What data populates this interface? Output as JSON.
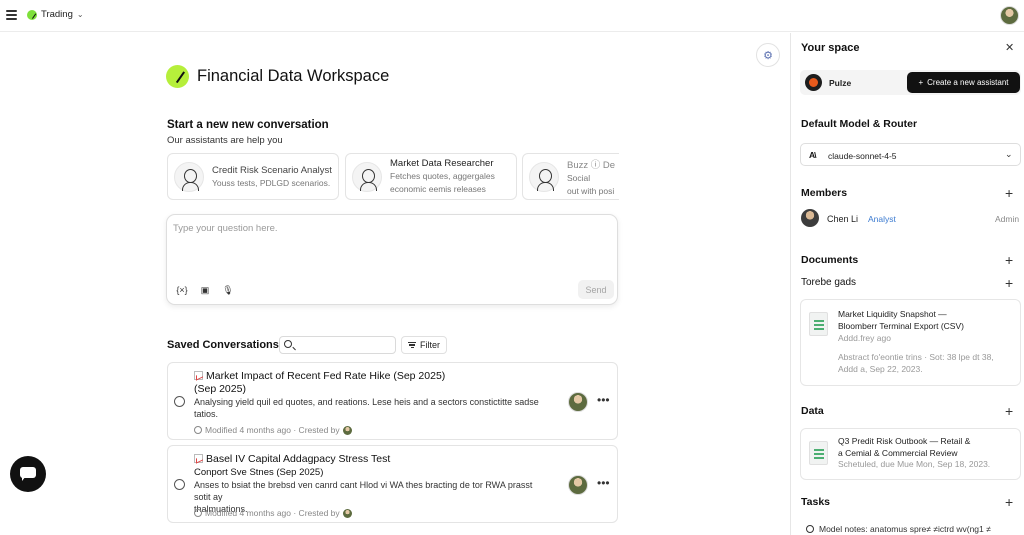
{
  "topbar": {
    "workspace_name": "Trading"
  },
  "main": {
    "brand_title": "Financial Data Workspace",
    "start_title": "Start a new  new conversation",
    "start_subtitle": "Our assistants are help you",
    "assistants": [
      {
        "name": "Credit Risk Scenario Analyst",
        "desc": "Youss tests, PDLGD scenarios."
      },
      {
        "name": "Market Data Researcher",
        "desc_line1": "Fetches quotes, aggergales",
        "desc_line2": "economic eemis releases"
      },
      {
        "name": "Buzz ⓘ De",
        "desc_line1": "Social",
        "desc_line2": "out with posi"
      }
    ],
    "composer": {
      "placeholder": "Type your question here.",
      "send_label": "Send"
    },
    "saved": {
      "title": "Saved Conversations",
      "search_placeholder": "",
      "filter_label": "Filter",
      "items": [
        {
          "title_line1": "Market Impact of Recent Fed Rate Hike (Sep 2025)",
          "title_line2": "(Sep 2025)",
          "desc_line1": "Analysing yield quil ed quotes, and reations. Lese heis and a sectors constictitte sadse",
          "desc_line2": "tatios.",
          "meta": "Modified 4 months ago · Crested by"
        },
        {
          "title_line1": "Basel IV Capital Addagpacy Stress Test",
          "title_line2": "Conport Sve Stnes (Sep 2025)",
          "desc_line1": "Anses to bsiat the brebsd ven canrd cant Hlod vi WA thes bracting de tor RWA prasst sotit ay",
          "desc_line2": "thalmuations.",
          "meta": "Modified 4 months ago · Crested by"
        }
      ]
    }
  },
  "panel": {
    "title": "Your space",
    "assistant_row": {
      "name": "Pulze",
      "create_label": "Create a new assistant"
    },
    "default_model": {
      "heading": "Default Model & Router",
      "logo": "A\\",
      "model_name": "claude-sonnet-4-5"
    },
    "members": {
      "heading": "Members",
      "list": [
        {
          "name": "Chen Li",
          "role": "Analyst",
          "permission": "Admin"
        }
      ]
    },
    "documents": {
      "heading": "Documents",
      "subheading": "Torebe gads",
      "items": [
        {
          "title_line1": "Market Liquidity Snapshot —",
          "title_line2": "Bloomberr Terminal Export (CSV)",
          "sub_line1": "Addd.frey ago",
          "sub_line2": "Abstract fo'eontie trins · Sot: 38 lpe dt 38,",
          "sub_line3": "Addd a, Sep 22, 2023."
        }
      ]
    },
    "data": {
      "heading": "Data",
      "items": [
        {
          "title_line1": "Q3 Predit Risk Outbook — Retail &",
          "title_line2": "a Cemial & Commercial Review",
          "sub_line1": "Schetuled, due Mue Mon, Sep 18, 2023."
        }
      ]
    },
    "tasks": {
      "heading": "Tasks",
      "first_task": "Model notes: anatomus spre≠ ≠ictrd wv(ng1 ≠"
    }
  },
  "colors": {
    "brand_green": "#b6ef3b",
    "accent_blue": "#3c7bd0",
    "pulze_orange": "#e85a1c",
    "dark_button": "#111111"
  }
}
